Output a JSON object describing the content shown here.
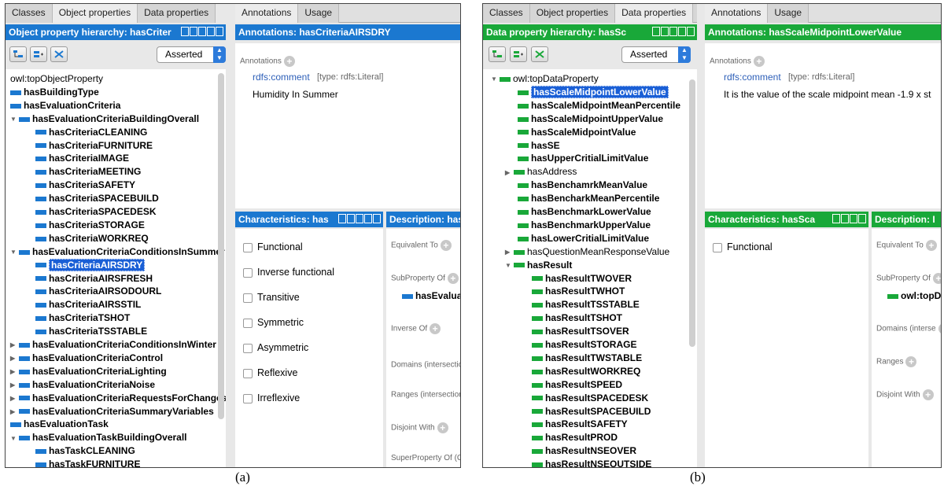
{
  "colors": {
    "object_accent": "#1b78d0",
    "data_accent": "#19a839",
    "selection": "#1a5fd6"
  },
  "panel_a": {
    "tabs": [
      "Classes",
      "Object properties",
      "Data properties"
    ],
    "active_tab": "Object properties",
    "right_tabs": [
      "Annotations",
      "Usage"
    ],
    "hierarchy_header": "Object property hierarchy: hasCriter",
    "annotations_header": "Annotations: hasCriteriaAIRSDRY",
    "asserted": "Asserted",
    "tree": [
      {
        "label": "owl:topObjectProperty",
        "bar": false,
        "tog": "",
        "bold": false
      },
      {
        "label": "hasBuildingType",
        "bar": true,
        "tog": "",
        "bold": true
      },
      {
        "label": "hasEvaluationCriteria",
        "bar": true,
        "tog": "",
        "bold": true
      },
      {
        "label": "hasEvaluationCriteriaBuildingOverall",
        "bar": true,
        "tog": "▼",
        "bold": true
      },
      {
        "label": "hasCriteriaCLEANING",
        "bar": true,
        "tog": "",
        "bold": true
      },
      {
        "label": "hasCriteriaFURNITURE",
        "bar": true,
        "tog": "",
        "bold": true
      },
      {
        "label": "hasCriteriaIMAGE",
        "bar": true,
        "tog": "",
        "bold": true
      },
      {
        "label": "hasCriteriaMEETING",
        "bar": true,
        "tog": "",
        "bold": true
      },
      {
        "label": "hasCriteriaSAFETY",
        "bar": true,
        "tog": "",
        "bold": true
      },
      {
        "label": "hasCriteriaSPACEBUILD",
        "bar": true,
        "tog": "",
        "bold": true
      },
      {
        "label": "hasCriteriaSPACEDESK",
        "bar": true,
        "tog": "",
        "bold": true
      },
      {
        "label": "hasCriteriaSTORAGE",
        "bar": true,
        "tog": "",
        "bold": true
      },
      {
        "label": "hasCriteriaWORKREQ",
        "bar": true,
        "tog": "",
        "bold": true
      },
      {
        "label": "hasEvaluationCriteriaConditionsInSummer",
        "bar": true,
        "tog": "▼",
        "bold": true
      },
      {
        "label": "hasCriteriaAIRSDRY",
        "bar": true,
        "tog": "",
        "bold": true,
        "selected": true
      },
      {
        "label": "hasCriteriaAIRSFRESH",
        "bar": true,
        "tog": "",
        "bold": true
      },
      {
        "label": "hasCriteriaAIRSODOURL",
        "bar": true,
        "tog": "",
        "bold": true
      },
      {
        "label": "hasCriteriaAIRSSTIL",
        "bar": true,
        "tog": "",
        "bold": true
      },
      {
        "label": "hasCriteriaTSHOT",
        "bar": true,
        "tog": "",
        "bold": true
      },
      {
        "label": "hasCriteriaTSSTABLE",
        "bar": true,
        "tog": "",
        "bold": true
      },
      {
        "label": "hasEvaluationCriteriaConditionsInWinter",
        "bar": true,
        "tog": "▶",
        "bold": true
      },
      {
        "label": "hasEvaluationCriteriaControl",
        "bar": true,
        "tog": "▶",
        "bold": true
      },
      {
        "label": "hasEvaluationCriteriaLighting",
        "bar": true,
        "tog": "▶",
        "bold": true
      },
      {
        "label": "hasEvaluationCriteriaNoise",
        "bar": true,
        "tog": "▶",
        "bold": true
      },
      {
        "label": "hasEvaluationCriteriaRequestsForChanges",
        "bar": true,
        "tog": "▶",
        "bold": true
      },
      {
        "label": "hasEvaluationCriteriaSummaryVariables",
        "bar": true,
        "tog": "▶",
        "bold": true
      },
      {
        "label": "hasEvaluationTask",
        "bar": true,
        "tog": "",
        "bold": true
      },
      {
        "label": "hasEvaluationTaskBuildingOverall",
        "bar": true,
        "tog": "▼",
        "bold": true
      },
      {
        "label": "hasTaskCLEANING",
        "bar": true,
        "tog": "",
        "bold": true
      },
      {
        "label": "hasTaskFURNITURE",
        "bar": true,
        "tog": "",
        "bold": true
      }
    ],
    "annotations_label": "Annotations",
    "comment_key": "rdfs:comment",
    "comment_type": "[type: rdfs:Literal]",
    "comment_value": "Humidity In Summer",
    "characteristics_header": "Characteristics: has",
    "description_header": "Description: has",
    "characteristics": [
      "Functional",
      "Inverse functional",
      "Transitive",
      "Symmetric",
      "Asymmetric",
      "Reflexive",
      "Irreflexive"
    ],
    "description_rows": [
      "Equivalent To",
      "SubProperty Of",
      "Inverse Of",
      "Domains (intersection)",
      "Ranges (intersection)",
      "Disjoint With",
      "SuperProperty Of (Ch"
    ],
    "subproperty_value": "hasEvaluat",
    "caption": "(a)"
  },
  "panel_b": {
    "tabs": [
      "Classes",
      "Object properties",
      "Data properties"
    ],
    "active_tab": "Data properties",
    "right_tabs": [
      "Annotations",
      "Usage"
    ],
    "hierarchy_header": "Data property hierarchy: hasSc",
    "annotations_header": "Annotations: hasScaleMidpointLowerValue",
    "asserted": "Asserted",
    "tree": [
      {
        "label": "owl:topDataProperty",
        "bar": true,
        "tog": "▼",
        "bold": false
      },
      {
        "label": "hasScaleMidpointLowerValue",
        "bar": true,
        "tog": "",
        "bold": true,
        "selected": true
      },
      {
        "label": "hasScaleMidpointMeanPercentile",
        "bar": true,
        "tog": "",
        "bold": true
      },
      {
        "label": "hasScaleMidpointUpperValue",
        "bar": true,
        "tog": "",
        "bold": true
      },
      {
        "label": "hasScaleMidpointValue",
        "bar": true,
        "tog": "",
        "bold": true
      },
      {
        "label": "hasSE",
        "bar": true,
        "tog": "",
        "bold": true
      },
      {
        "label": "hasUpperCritialLimitValue",
        "bar": true,
        "tog": "",
        "bold": true
      },
      {
        "label": "hasAddress",
        "bar": true,
        "tog": "▶",
        "bold": false
      },
      {
        "label": "hasBenchamrkMeanValue",
        "bar": true,
        "tog": "",
        "bold": true
      },
      {
        "label": "hasBencharkMeanPercentile",
        "bar": true,
        "tog": "",
        "bold": true
      },
      {
        "label": "hasBenchmarkLowerValue",
        "bar": true,
        "tog": "",
        "bold": true
      },
      {
        "label": "hasBenchmarkUpperValue",
        "bar": true,
        "tog": "",
        "bold": true
      },
      {
        "label": "hasLowerCritialLimitValue",
        "bar": true,
        "tog": "",
        "bold": true
      },
      {
        "label": "hasQuestionMeanResponseValue",
        "bar": true,
        "tog": "▶",
        "bold": false
      },
      {
        "label": "hasResult",
        "bar": true,
        "tog": "▼",
        "bold": true
      },
      {
        "label": "hasResultTWOVER",
        "bar": true,
        "tog": "",
        "bold": true
      },
      {
        "label": "hasResultTWHOT",
        "bar": true,
        "tog": "",
        "bold": true
      },
      {
        "label": "hasResultTSSTABLE",
        "bar": true,
        "tog": "",
        "bold": true
      },
      {
        "label": "hasResultTSHOT",
        "bar": true,
        "tog": "",
        "bold": true
      },
      {
        "label": "hasResultTSOVER",
        "bar": true,
        "tog": "",
        "bold": true
      },
      {
        "label": "hasResultSTORAGE",
        "bar": true,
        "tog": "",
        "bold": true
      },
      {
        "label": "hasResultTWSTABLE",
        "bar": true,
        "tog": "",
        "bold": true
      },
      {
        "label": "hasResultWORKREQ",
        "bar": true,
        "tog": "",
        "bold": true
      },
      {
        "label": "hasResultSPEED",
        "bar": true,
        "tog": "",
        "bold": true
      },
      {
        "label": "hasResultSPACEDESK",
        "bar": true,
        "tog": "",
        "bold": true
      },
      {
        "label": "hasResultSPACEBUILD",
        "bar": true,
        "tog": "",
        "bold": true
      },
      {
        "label": "hasResultSAFETY",
        "bar": true,
        "tog": "",
        "bold": true
      },
      {
        "label": "hasResultPROD",
        "bar": true,
        "tog": "",
        "bold": true
      },
      {
        "label": "hasResultNSEOVER",
        "bar": true,
        "tog": "",
        "bold": true
      },
      {
        "label": "hasResultNSEOUTSIDE",
        "bar": true,
        "tog": "",
        "bold": true
      }
    ],
    "annotations_label": "Annotations",
    "comment_key": "rdfs:comment",
    "comment_type": "[type: rdfs:Literal]",
    "comment_value": "It is the value of the scale midpoint mean -1.9 x st",
    "characteristics_header": "Characteristics: hasSca",
    "description_header": "Description: I",
    "characteristics": [
      "Functional"
    ],
    "description_rows": [
      "Equivalent To",
      "SubProperty Of",
      "Domains (interse",
      "Ranges",
      "Disjoint With"
    ],
    "subproperty_value": "owl:topD",
    "caption": "(b)"
  }
}
